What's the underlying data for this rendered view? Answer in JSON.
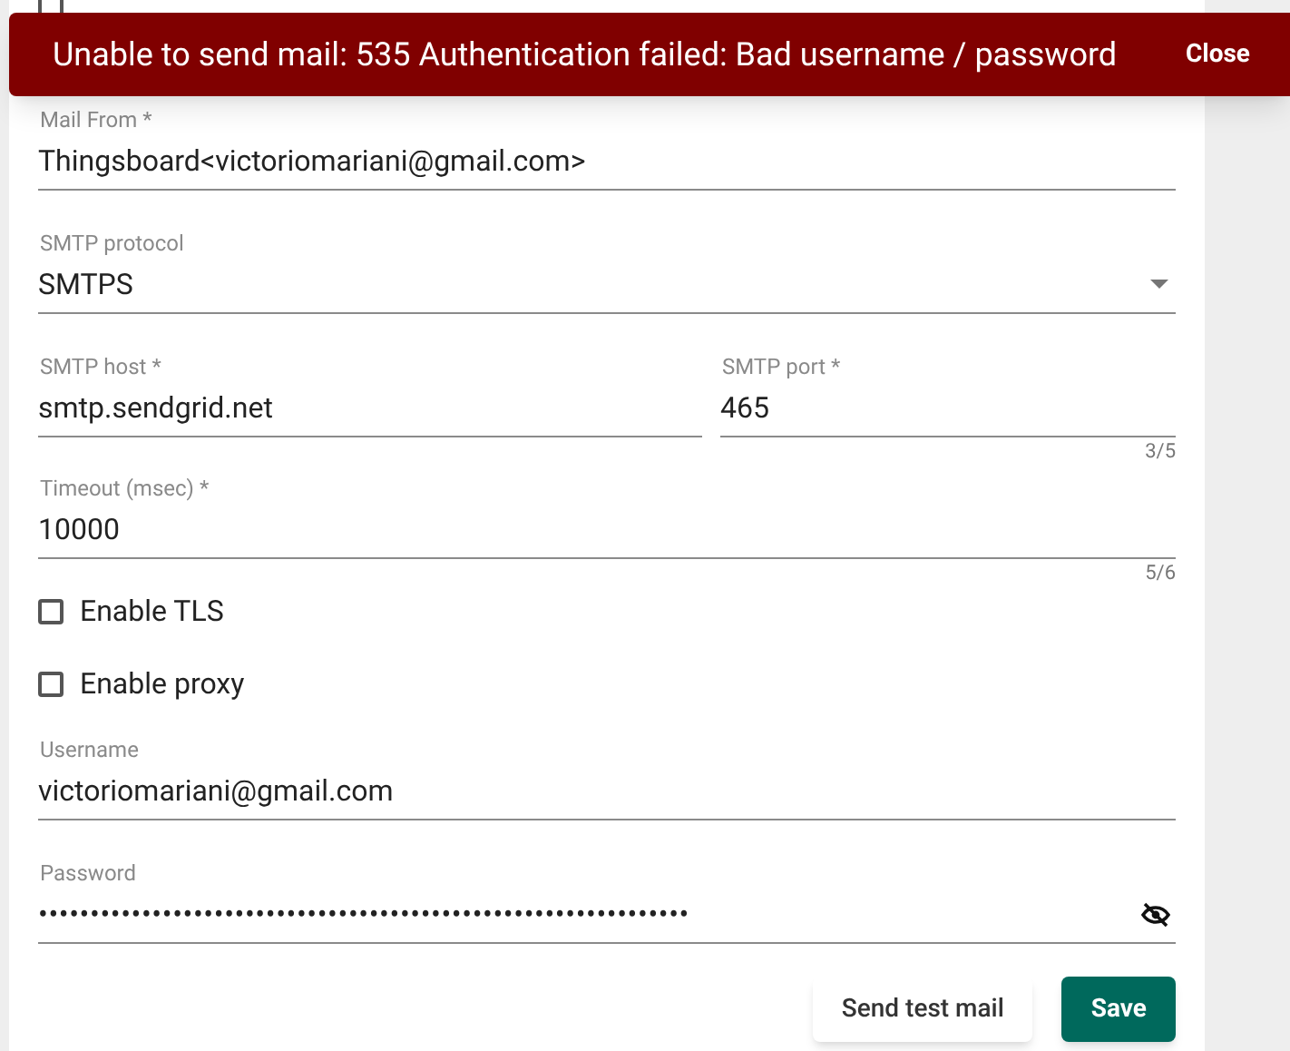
{
  "use_system_settings": {
    "checked": false
  },
  "snackbar": {
    "message": "Unable to send mail: 535 Authentication failed: Bad username / password",
    "action": "Close"
  },
  "fields": [
    {
      "kind": "text",
      "label": "Mail From *",
      "value": "Thingsboard<victoriomariani@gmail.com>"
    },
    {
      "kind": "select",
      "label": "SMTP protocol",
      "value": "SMTPS"
    },
    {
      "kind": "pair",
      "fields": [
        {
          "label": "SMTP host *",
          "value": "smtp.sendgrid.net"
        },
        {
          "label": "SMTP port *",
          "value": "465",
          "hint": "3/5"
        }
      ]
    },
    {
      "kind": "text",
      "label": "Timeout (msec) *",
      "value": "10000",
      "hint": "5/6"
    },
    {
      "kind": "checkbox",
      "label": "Enable TLS",
      "checked": false
    },
    {
      "kind": "checkbox",
      "label": "Enable proxy",
      "checked": false
    },
    {
      "kind": "text",
      "label": "Username",
      "value": "victoriomariani@gmail.com"
    },
    {
      "kind": "password",
      "label": "Password",
      "value": "•••••••••••••••••••••••••••••••••••••••••••••••••••••••••••••••"
    }
  ],
  "buttons": [
    {
      "label": "Send test mail"
    },
    {
      "label": "Save"
    }
  ]
}
